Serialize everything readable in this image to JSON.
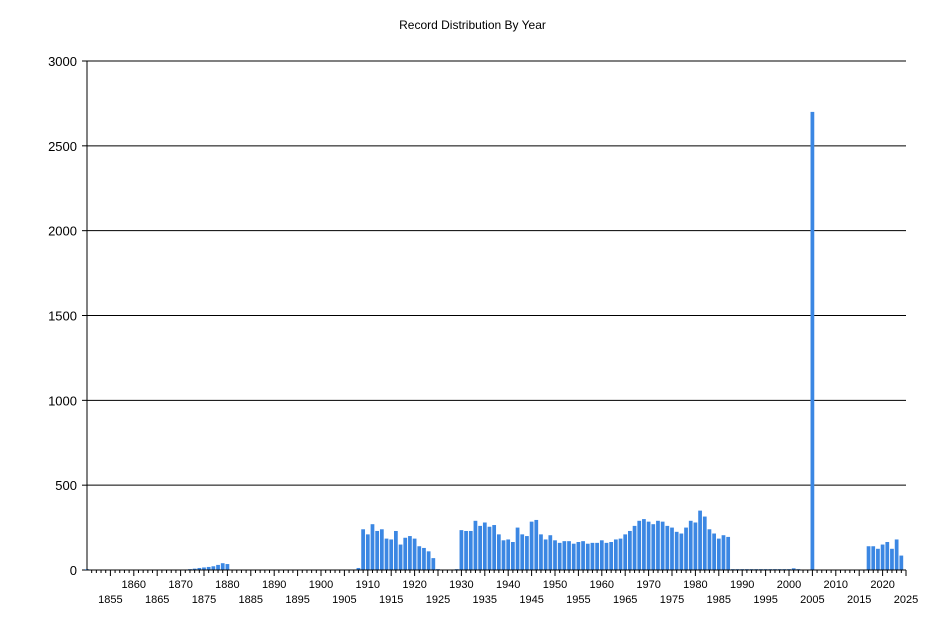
{
  "chart_data": {
    "type": "bar",
    "title": "Record Distribution By Year",
    "xlabel": "",
    "ylabel": "",
    "ylim": [
      0,
      3000
    ],
    "xlim": [
      1850,
      2025
    ],
    "yticks": [
      0,
      500,
      1000,
      1500,
      2000,
      2500,
      3000
    ],
    "xticks": [
      1855,
      1860,
      1865,
      1870,
      1875,
      1880,
      1885,
      1890,
      1895,
      1900,
      1905,
      1910,
      1915,
      1920,
      1925,
      1930,
      1935,
      1940,
      1945,
      1950,
      1955,
      1960,
      1965,
      1970,
      1975,
      1980,
      1985,
      1990,
      1995,
      2000,
      2005,
      2010,
      2015,
      2020,
      2025
    ],
    "grid": "horizontal",
    "legend": "none",
    "bar_color": "#3b87e3",
    "x": [
      1850,
      1871,
      1872,
      1873,
      1874,
      1875,
      1876,
      1877,
      1878,
      1879,
      1880,
      1908,
      1909,
      1910,
      1911,
      1912,
      1913,
      1914,
      1915,
      1916,
      1917,
      1918,
      1919,
      1920,
      1921,
      1922,
      1923,
      1924,
      1925,
      1929,
      1930,
      1931,
      1932,
      1933,
      1934,
      1935,
      1936,
      1937,
      1938,
      1939,
      1940,
      1941,
      1942,
      1943,
      1944,
      1945,
      1946,
      1947,
      1948,
      1949,
      1950,
      1951,
      1952,
      1953,
      1954,
      1955,
      1956,
      1957,
      1958,
      1959,
      1960,
      1961,
      1962,
      1963,
      1964,
      1965,
      1966,
      1967,
      1968,
      1969,
      1970,
      1971,
      1972,
      1973,
      1974,
      1975,
      1976,
      1977,
      1978,
      1979,
      1980,
      1981,
      1982,
      1983,
      1984,
      1985,
      1986,
      1987,
      1988,
      1989,
      1990,
      1991,
      1992,
      1993,
      1994,
      1995,
      1996,
      1997,
      1998,
      1999,
      2000,
      2001,
      2002,
      2005,
      2017,
      2018,
      2019,
      2020,
      2021,
      2022,
      2023,
      2024
    ],
    "values": [
      5,
      3,
      5,
      8,
      12,
      15,
      18,
      22,
      30,
      40,
      35,
      12,
      240,
      210,
      270,
      230,
      240,
      185,
      180,
      230,
      150,
      190,
      200,
      185,
      140,
      130,
      110,
      70,
      5,
      5,
      235,
      230,
      230,
      290,
      260,
      280,
      255,
      265,
      210,
      175,
      180,
      165,
      250,
      210,
      200,
      285,
      295,
      210,
      180,
      205,
      175,
      160,
      170,
      170,
      155,
      165,
      170,
      155,
      160,
      160,
      175,
      160,
      165,
      180,
      185,
      210,
      230,
      260,
      290,
      300,
      285,
      270,
      290,
      285,
      260,
      250,
      225,
      215,
      250,
      290,
      280,
      350,
      315,
      240,
      215,
      185,
      205,
      195,
      5,
      5,
      5,
      5,
      5,
      5,
      5,
      5,
      5,
      5,
      5,
      5,
      5,
      10,
      5,
      2700,
      140,
      140,
      125,
      150,
      165,
      125,
      180,
      85
    ]
  }
}
